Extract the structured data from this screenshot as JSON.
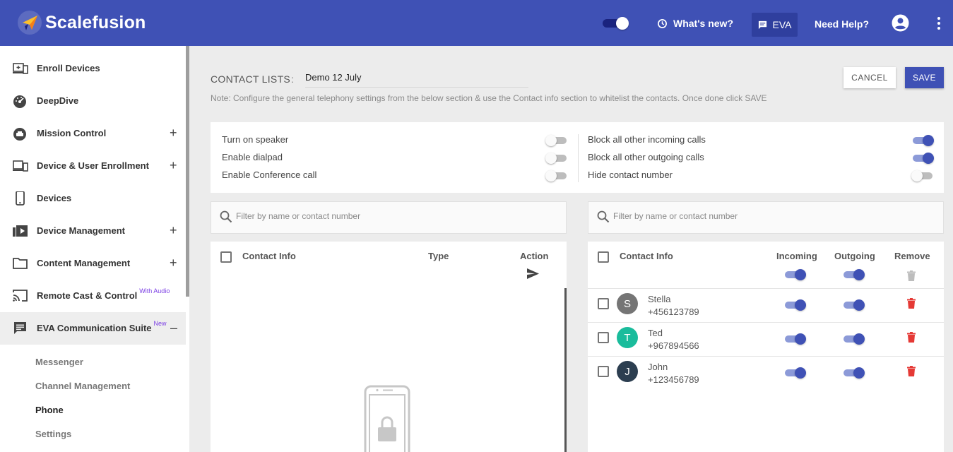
{
  "header": {
    "brand": "Scalefusion",
    "whats_new": "What's new?",
    "eva": "EVA",
    "need_help": "Need Help?",
    "toggle_on": true
  },
  "sidebar": {
    "items": [
      {
        "label": "Enroll Devices",
        "icon": "enroll-devices-icon",
        "expandable": false
      },
      {
        "label": "DeepDive",
        "icon": "dashboard-gauge-icon",
        "expandable": false
      },
      {
        "label": "Mission Control",
        "icon": "mission-control-icon",
        "expandable": true
      },
      {
        "label": "Device & User Enrollment",
        "icon": "device-enrollment-icon",
        "expandable": true
      },
      {
        "label": "Devices",
        "icon": "phone-icon",
        "expandable": false
      },
      {
        "label": "Device Management",
        "icon": "device-management-icon",
        "expandable": true
      },
      {
        "label": "Content Management",
        "icon": "folder-icon",
        "expandable": true
      },
      {
        "label": "Remote Cast & Control",
        "badge": "With Audio",
        "icon": "cast-icon",
        "expandable": false
      },
      {
        "label": "EVA Communication Suite",
        "badge": "New",
        "icon": "chat-icon",
        "expandable": true,
        "expanded": true
      }
    ],
    "subitems": [
      "Messenger",
      "Channel Management",
      "Phone",
      "Settings"
    ],
    "current_subitem": "Phone"
  },
  "main": {
    "section_title": "CONTACT LISTS",
    "separator": ":",
    "list_name": "Demo 12 July",
    "note": "Note: Configure the general telephony settings from the below section & use the Contact info section to whitelist the contacts. Once done click SAVE",
    "cancel": "CANCEL",
    "save": "SAVE"
  },
  "settings": {
    "left": [
      {
        "label": "Turn on speaker",
        "on": false
      },
      {
        "label": "Enable dialpad",
        "on": false
      },
      {
        "label": "Enable Conference call",
        "on": false
      }
    ],
    "right": [
      {
        "label": "Block all other incoming calls",
        "on": true
      },
      {
        "label": "Block all other outgoing calls",
        "on": true
      },
      {
        "label": "Hide contact number",
        "on": false
      }
    ]
  },
  "left_panel": {
    "search_placeholder": "Filter by name or contact number",
    "columns": {
      "contact": "Contact Info",
      "type": "Type",
      "action": "Action"
    }
  },
  "right_panel": {
    "search_placeholder": "Filter by name or contact number",
    "columns": {
      "contact": "Contact Info",
      "incoming": "Incoming",
      "outgoing": "Outgoing",
      "remove": "Remove"
    },
    "contacts": [
      {
        "initial": "S",
        "name": "Stella",
        "number": "+456123789",
        "color": "#757575",
        "incoming": true,
        "outgoing": true
      },
      {
        "initial": "T",
        "name": "Ted",
        "number": "+967894566",
        "color": "#1abc9c",
        "incoming": true,
        "outgoing": true
      },
      {
        "initial": "J",
        "name": "John",
        "number": "+123456789",
        "color": "#2c3e50",
        "incoming": true,
        "outgoing": true
      }
    ]
  },
  "colors": {
    "primary": "#3f51b5",
    "delete": "#e53935"
  }
}
